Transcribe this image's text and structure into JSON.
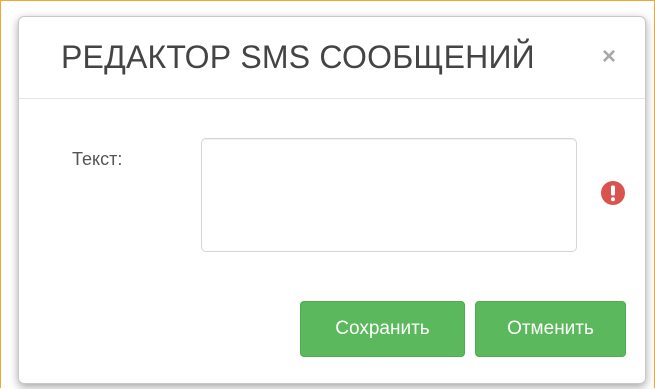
{
  "dialog": {
    "title": "РЕДАКТОР SMS СООБЩЕНИЙ",
    "close_glyph": "×"
  },
  "form": {
    "text_label": "Текст:",
    "text_value": "",
    "error_state": true
  },
  "buttons": {
    "save_label": "Сохранить",
    "cancel_label": "Отменить"
  },
  "colors": {
    "primary_button": "#5cb85c",
    "error_icon": "#d9534f",
    "frame_border": "#f0a830"
  }
}
